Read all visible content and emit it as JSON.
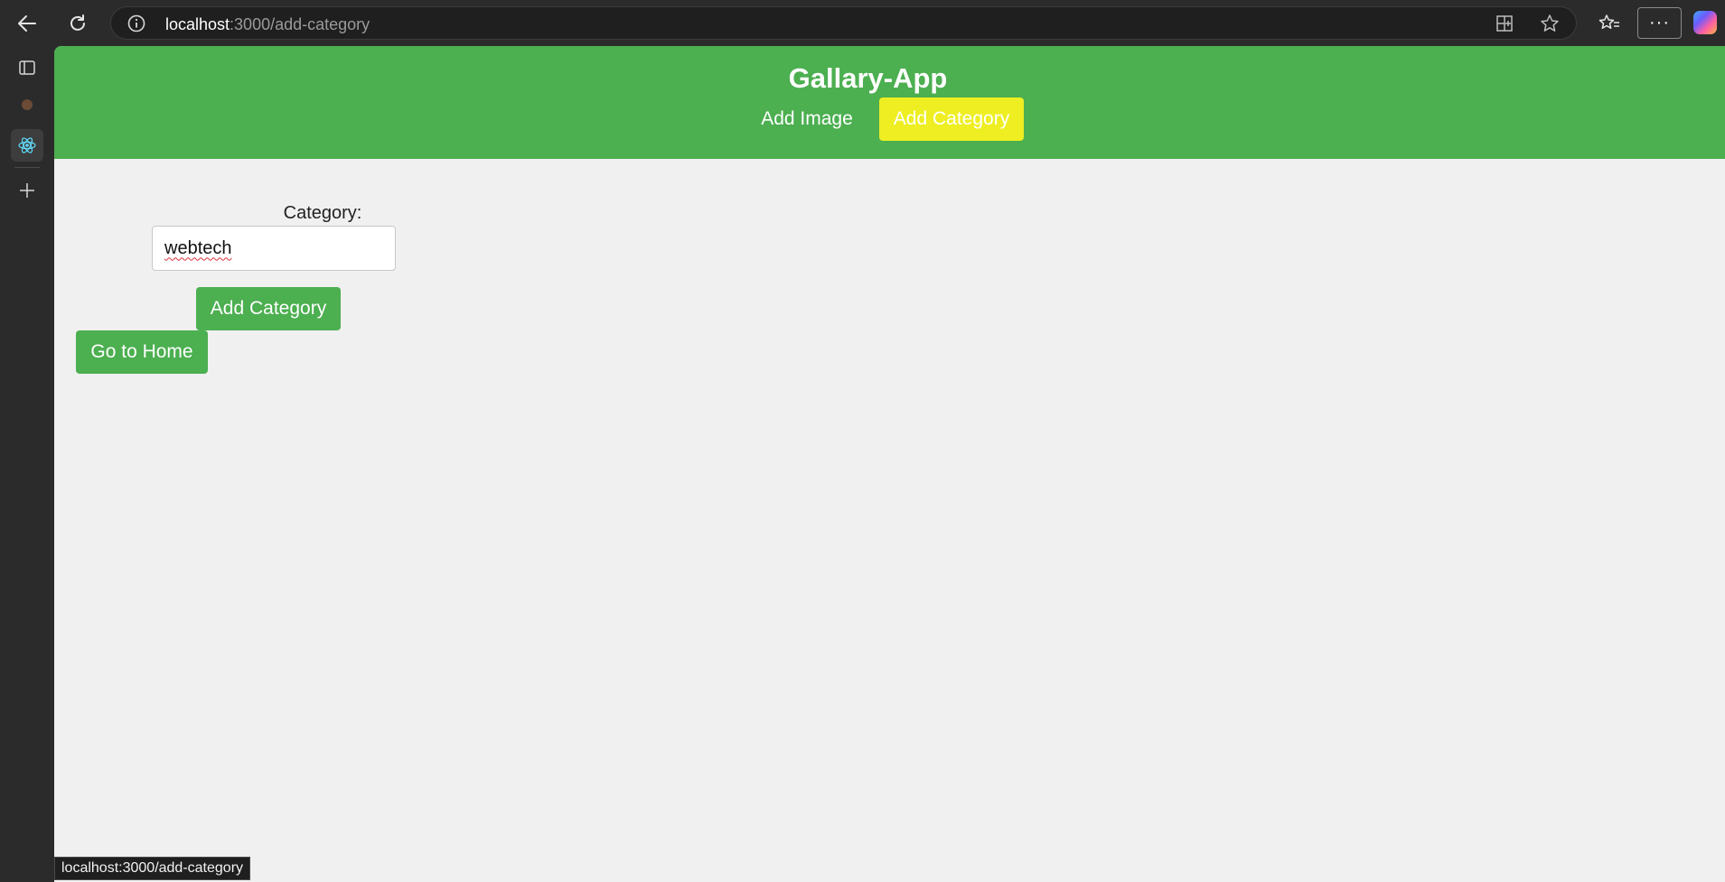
{
  "browser": {
    "url_host": "localhost",
    "url_path": ":3000/add-category",
    "status_url": "localhost:3000/add-category",
    "more_label": "···"
  },
  "header": {
    "title": "Gallary-App",
    "nav": [
      {
        "label": "Add Image",
        "active": false
      },
      {
        "label": "Add Category",
        "active": true
      }
    ]
  },
  "form": {
    "category_label": "Category:",
    "category_value": "webtech",
    "submit_label": "Add Category"
  },
  "home_button_label": "Go to Home",
  "colors": {
    "header_green": "#4caf50",
    "active_nav_yellow": "#eeee22",
    "page_bg": "#f0f0f0"
  }
}
